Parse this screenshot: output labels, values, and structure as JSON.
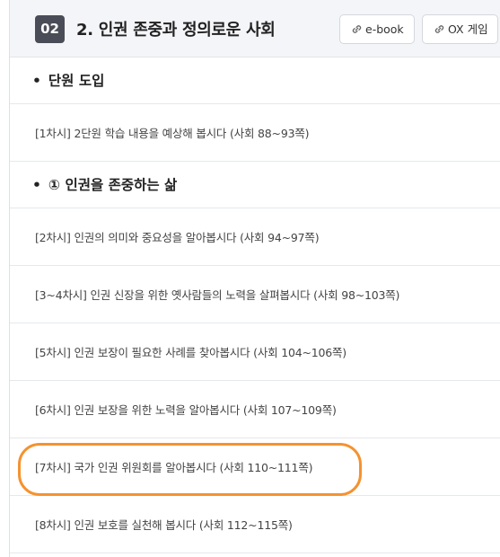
{
  "header": {
    "unit_number": "02",
    "unit_title": "2. 인권 존중과 정의로운 사회",
    "ebook_label": "e-book",
    "ox_label": "OX 게임"
  },
  "sections": [
    {
      "bullet": "•",
      "title": "단원 도입"
    },
    {
      "bullet": "•",
      "title": "① 인권을 존중하는 삶"
    }
  ],
  "lessons": [
    {
      "label": "[1차시] 2단원 학습 내용을 예상해 봅시다 (사회 88~93쪽)"
    },
    {
      "label": "[2차시] 인권의 의미와 중요성을 알아봅시다 (사회 94~97쪽)"
    },
    {
      "label": "[3~4차시] 인권 신장을 위한 옛사람들의 노력을 살펴봅시다 (사회 98~103쪽)"
    },
    {
      "label": "[5차시] 인권 보장이 필요한 사례를 찾아봅시다 (사회 104~106쪽)"
    },
    {
      "label": "[6차시] 인권 보장을 위한 노력을 알아봅시다 (사회 107~109쪽)"
    },
    {
      "label": "[7차시] 국가 인권 위원회를 알아봅시다 (사회 110~111쪽)"
    },
    {
      "label": "[8차시] 인권 보호를 실천해 봅시다 (사회 112~115쪽)"
    }
  ],
  "colors": {
    "badge_bg": "#4a4d57",
    "header_bg": "#f4f5f8",
    "highlight": "#f5922f"
  }
}
